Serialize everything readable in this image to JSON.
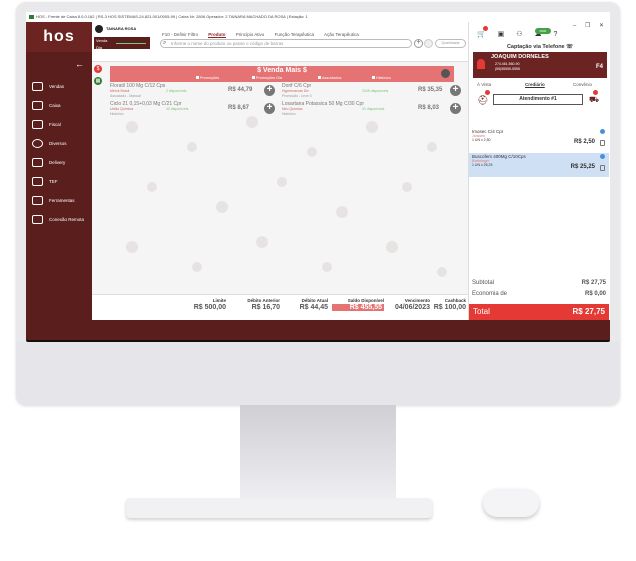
{
  "window": {
    "title": "HOS - Frente de Caixa 8.0.0.162 | RS-3 HOS SISTEMAS-24.821.001/0005-99 | Caixa Nr: 2806 Operador: 2 TAINARA MACHADO DA ROSA | Estação: 1"
  },
  "sidebar": {
    "logo": "hos",
    "items": [
      {
        "label": "Vendas",
        "icon": "cart-icon"
      },
      {
        "label": "Caixa",
        "icon": "cash-register-icon"
      },
      {
        "label": "Fiscal",
        "icon": "fiscal-icon"
      },
      {
        "label": "Diversos",
        "icon": "more-icon"
      },
      {
        "label": "Delivery",
        "icon": "delivery-truck-icon"
      },
      {
        "label": "TEF",
        "icon": "card-terminal-icon"
      },
      {
        "label": "Ferramentas",
        "icon": "tools-icon"
      },
      {
        "label": "Conexão Remota",
        "icon": "remote-icon"
      }
    ]
  },
  "user": {
    "name": "TAINARA ROSA",
    "sales_label": "Venda",
    "day_label": "Dia"
  },
  "tabs": [
    "F10 - Definir Filtro",
    "Produto",
    "Princípio Ativo",
    "Função Terapêutica",
    "Ação Terapêutica"
  ],
  "search": {
    "placeholder": "Informe o nome do produto ou passe o código de barras",
    "quantity_placeholder": "Quantidade"
  },
  "banner": {
    "title": "$ Venda Mais $",
    "legend": [
      "Promoções",
      "Promoções Dia",
      "Associados",
      "Histórico"
    ]
  },
  "products": [
    {
      "name": "Floratil 100 Mg C/12 Cps",
      "lab": "Merck Brasil",
      "type": "Associado - Manual",
      "stock": "2 disponíveis",
      "price": "R$ 44,79"
    },
    {
      "name": "Dorif C/6 Cpr",
      "lab": "Hypermarcas Div",
      "type": "Promoção - Leve 3",
      "stock": "2045 disponíveis",
      "price": "R$ 35,35"
    },
    {
      "name": "Ciclo 21 0,15+0,03 Mg C/21 Cpr",
      "lab": "União Química",
      "type": "Histórico",
      "stock": "40 disponíveis",
      "price": "R$ 8,67"
    },
    {
      "name": "Losartana Potassica 50 Mg C/30 Cpr",
      "lab": "Neo Química",
      "type": "Histórico",
      "stock": "31 disponíveis",
      "price": "R$ 8,03"
    }
  ],
  "footer": [
    {
      "label": "Limite",
      "value": "R$ 500,00"
    },
    {
      "label": "Débito Anterior",
      "value": "R$ 16,70"
    },
    {
      "label": "Débito Atual",
      "value": "R$ 44,45"
    },
    {
      "label": "Saldo Disponível",
      "value": "R$ 455,55"
    },
    {
      "label": "Vencimento",
      "value": "04/06/2023"
    },
    {
      "label": "Cashback",
      "value": "R$ 100,00"
    }
  ],
  "right": {
    "window_controls": [
      "–",
      "❐",
      "✕"
    ],
    "whatsapp_badge": "0000",
    "capture": "Captação via Telefone",
    "client": {
      "name": "JOAQUIM DORNELES",
      "cpf": "274.461.560-90",
      "phone": "(55)55555-5555",
      "key": "F4"
    },
    "pay_tabs": [
      "À Vista",
      "Crediário",
      "Convênio"
    ],
    "attendance": "Atendimento #1",
    "cart": [
      {
        "name": "Imosec C/4 Cpr",
        "lab": "Janssen",
        "qty": "1 UN x 2,50",
        "price": "R$ 2,50"
      },
      {
        "name": "Buscofem 400Mg C/10Cps",
        "lab": "Boehringer",
        "qty": "1 UN x 25,25",
        "price": "R$ 25,25"
      }
    ],
    "subtotal_label": "Subtotal",
    "subtotal_value": "R$ 27,75",
    "economy_label": "Economia de",
    "economy_value": "R$ 0,00",
    "total_label": "Total",
    "total_value": "R$ 27,75"
  },
  "colors": {
    "brand": "#5a1f1d",
    "banner": "#e57373",
    "total": "#e53935",
    "selected_item": "#cfe0f5"
  }
}
